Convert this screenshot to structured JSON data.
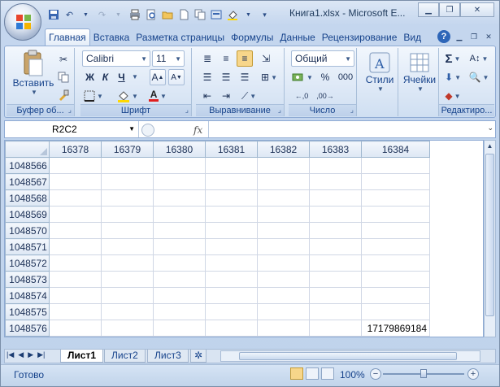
{
  "window": {
    "title": "Книга1.xlsx - Microsoft E..."
  },
  "qat": {
    "icons": [
      "save-icon",
      "undo-icon",
      "redo-icon",
      "print-icon",
      "print-preview-icon",
      "open-icon",
      "new-icon",
      "copy-icon",
      "format-painter-icon",
      "fill-color-icon"
    ]
  },
  "tabs": [
    "Главная",
    "Вставка",
    "Разметка страницы",
    "Формулы",
    "Данные",
    "Рецензирование",
    "Вид"
  ],
  "ribbon": {
    "clipboard": {
      "label": "Буфер об...",
      "paste": "Вставить"
    },
    "font": {
      "label": "Шрифт",
      "name": "Calibri",
      "size": "11",
      "bold": "Ж",
      "italic": "К",
      "underline": "Ч",
      "grow": "A",
      "shrink": "A",
      "fontcolor": "A"
    },
    "alignment": {
      "label": "Выравнивание"
    },
    "number": {
      "label": "Число",
      "format": "Общий",
      "percent": "%",
      "thousands": "000"
    },
    "styles": {
      "label": "Стили"
    },
    "cells": {
      "label": "Ячейки"
    },
    "editing": {
      "label": "Редактиро..."
    }
  },
  "formula_bar": {
    "name_box": "R2C2",
    "fx": "fx",
    "content": ""
  },
  "grid": {
    "columns": [
      "16378",
      "16379",
      "16380",
      "16381",
      "16382",
      "16383",
      "16384"
    ],
    "rows": [
      {
        "header": "1048566",
        "cells": [
          "",
          "",
          "",
          "",
          "",
          "",
          ""
        ]
      },
      {
        "header": "1048567",
        "cells": [
          "",
          "",
          "",
          "",
          "",
          "",
          ""
        ]
      },
      {
        "header": "1048568",
        "cells": [
          "",
          "",
          "",
          "",
          "",
          "",
          ""
        ]
      },
      {
        "header": "1048569",
        "cells": [
          "",
          "",
          "",
          "",
          "",
          "",
          ""
        ]
      },
      {
        "header": "1048570",
        "cells": [
          "",
          "",
          "",
          "",
          "",
          "",
          ""
        ]
      },
      {
        "header": "1048571",
        "cells": [
          "",
          "",
          "",
          "",
          "",
          "",
          ""
        ]
      },
      {
        "header": "1048572",
        "cells": [
          "",
          "",
          "",
          "",
          "",
          "",
          ""
        ]
      },
      {
        "header": "1048573",
        "cells": [
          "",
          "",
          "",
          "",
          "",
          "",
          ""
        ]
      },
      {
        "header": "1048574",
        "cells": [
          "",
          "",
          "",
          "",
          "",
          "",
          ""
        ]
      },
      {
        "header": "1048575",
        "cells": [
          "",
          "",
          "",
          "",
          "",
          "",
          ""
        ]
      },
      {
        "header": "1048576",
        "cells": [
          "",
          "",
          "",
          "",
          "",
          "",
          "17179869184"
        ]
      }
    ]
  },
  "sheets": [
    "Лист1",
    "Лист2",
    "Лист3"
  ],
  "status": {
    "text": "Готово",
    "zoom": "100%"
  }
}
